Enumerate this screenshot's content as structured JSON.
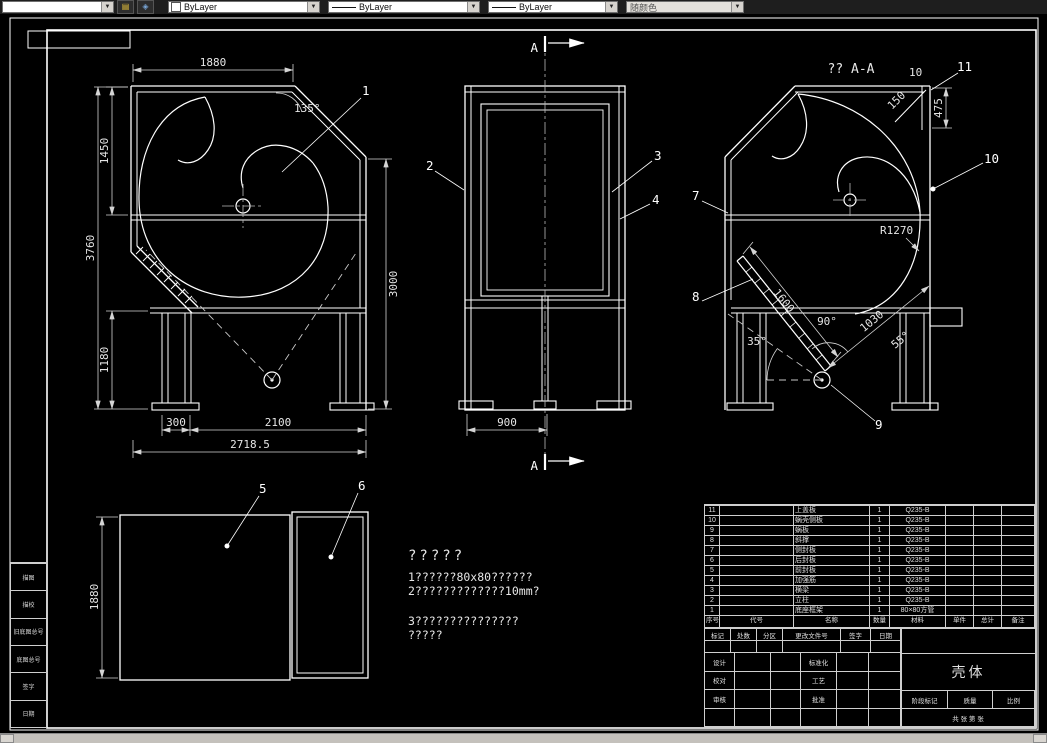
{
  "toolbar": {
    "layer_value": "",
    "color_value": "ByLayer",
    "linetype_value": "ByLayer",
    "lineweight_value": "ByLayer",
    "plotstyle_value": "随颜色"
  },
  "drawing": {
    "balloons": {
      "b1": "1",
      "b2": "2",
      "b3": "3",
      "b4": "4",
      "b5": "5",
      "b6": "6",
      "b7": "7",
      "b8": "8",
      "b9": "9",
      "b10": "10",
      "b11": "11"
    },
    "plan": {
      "width": "1880",
      "h_top": "1450",
      "h_total": "3760",
      "h_base": "1180",
      "base_left": "300",
      "base_mid": "2100",
      "base_total": "2718.5",
      "h_right": "3000",
      "chamfer_angle": "135°"
    },
    "front": {
      "width": "900",
      "section_letter": "A"
    },
    "section": {
      "title": "?? A-A",
      "radius": "R1270",
      "strut_len": "1600",
      "diag_len": "1030",
      "angle_90": "90°",
      "angle_35": "35°",
      "angle_55": "55°",
      "plate_150": "150",
      "plate_10": "10",
      "plate_475": "475"
    },
    "bottom": {
      "height": "1880"
    }
  },
  "notes": {
    "line1": "?????",
    "line2": "1??????80x80??????",
    "line3": "2?????????????10mm?",
    "line4": "3???????????????",
    "line5": "?????"
  },
  "parts_table": {
    "headers": {
      "no": "序号",
      "code": "代号",
      "name": "名称",
      "qty": "数量",
      "material": "材料",
      "unit": "单件",
      "total": "总计",
      "remark": "备注"
    },
    "rows": [
      {
        "no": "11",
        "code": "",
        "name": "上盖板",
        "qty": "1",
        "material": "Q235-B",
        "unit": "",
        "total": "",
        "remark": ""
      },
      {
        "no": "10",
        "code": "",
        "name": "蜗壳侧板",
        "qty": "1",
        "material": "Q235-B",
        "unit": "",
        "total": "",
        "remark": ""
      },
      {
        "no": "9",
        "code": "",
        "name": "蜗板",
        "qty": "1",
        "material": "Q235-B",
        "unit": "",
        "total": "",
        "remark": ""
      },
      {
        "no": "8",
        "code": "",
        "name": "斜撑",
        "qty": "1",
        "material": "Q235-B",
        "unit": "",
        "total": "",
        "remark": ""
      },
      {
        "no": "7",
        "code": "",
        "name": "侧封板",
        "qty": "1",
        "material": "Q235-B",
        "unit": "",
        "total": "",
        "remark": ""
      },
      {
        "no": "6",
        "code": "",
        "name": "后封板",
        "qty": "1",
        "material": "Q235-B",
        "unit": "",
        "total": "",
        "remark": ""
      },
      {
        "no": "5",
        "code": "",
        "name": "前封板",
        "qty": "1",
        "material": "Q235-B",
        "unit": "",
        "total": "",
        "remark": ""
      },
      {
        "no": "4",
        "code": "",
        "name": "加强筋",
        "qty": "1",
        "material": "Q235-B",
        "unit": "",
        "total": "",
        "remark": ""
      },
      {
        "no": "3",
        "code": "",
        "name": "横梁",
        "qty": "1",
        "material": "Q235-B",
        "unit": "",
        "total": "",
        "remark": ""
      },
      {
        "no": "2",
        "code": "",
        "name": "立柱",
        "qty": "1",
        "material": "Q235-B",
        "unit": "",
        "total": "",
        "remark": ""
      },
      {
        "no": "1",
        "code": "",
        "name": "底座框架",
        "qty": "1",
        "material": "80×80方管",
        "unit": "",
        "total": "",
        "remark": ""
      }
    ]
  },
  "title_block": {
    "part_name": "壳体",
    "rev_headers": [
      "标记",
      "处数",
      "分区",
      "更改文件号",
      "签字",
      "日期"
    ],
    "sig": [
      "设计",
      "标准化",
      "校对",
      "工艺",
      "审核",
      "批准"
    ],
    "stage": "阶段标记",
    "quality": "质量",
    "scale": "比例",
    "sheets": "共 张 第 张"
  },
  "margin_boxes": [
    {
      "label": "描图"
    },
    {
      "label": "描校"
    },
    {
      "label": "旧底图总号"
    },
    {
      "label": "底图总号"
    },
    {
      "label": "签字"
    },
    {
      "label": "日期"
    }
  ]
}
